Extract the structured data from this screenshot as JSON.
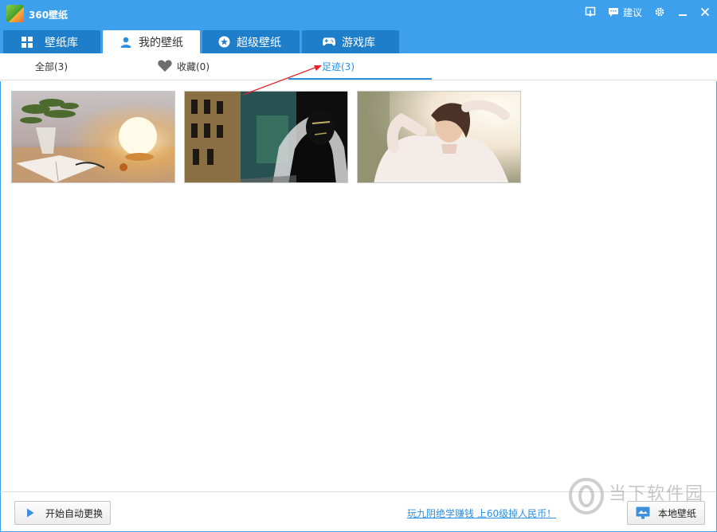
{
  "app": {
    "title": "360壁纸",
    "logo_icon": "wallpaper-logo-icon"
  },
  "window": {
    "feedback_label": "建议"
  },
  "tabs": [
    {
      "label": "壁纸库",
      "icon": "grid-icon"
    },
    {
      "label": "我的壁纸",
      "icon": "user-icon",
      "active": true
    },
    {
      "label": "超级壁纸",
      "icon": "star-icon"
    },
    {
      "label": "游戏库",
      "icon": "gamepad-icon"
    }
  ],
  "subtabs": [
    {
      "label": "全部(3)"
    },
    {
      "label": "收藏(0)",
      "icon": "heart-icon"
    },
    {
      "label": "足迹(3)",
      "active": true
    }
  ],
  "wallpapers": [
    {
      "subject": "book and glowing lamp"
    },
    {
      "subject": "dark artistic portrait with buildings"
    },
    {
      "subject": "woman in white blouse in sunlight"
    }
  ],
  "footer": {
    "auto_change_label": "开始自动更换",
    "promo_link": "玩九阴绝学赚钱 上60级掉人民币！",
    "local_wallpaper_label": "本地壁纸"
  },
  "watermark": {
    "text": "当下软件园"
  },
  "colors": {
    "title_bar": "#3da0ec",
    "tab_inactive": "#1e7ec9",
    "accent": "#2c8fe0",
    "annotation_arrow": "#e8232a"
  }
}
